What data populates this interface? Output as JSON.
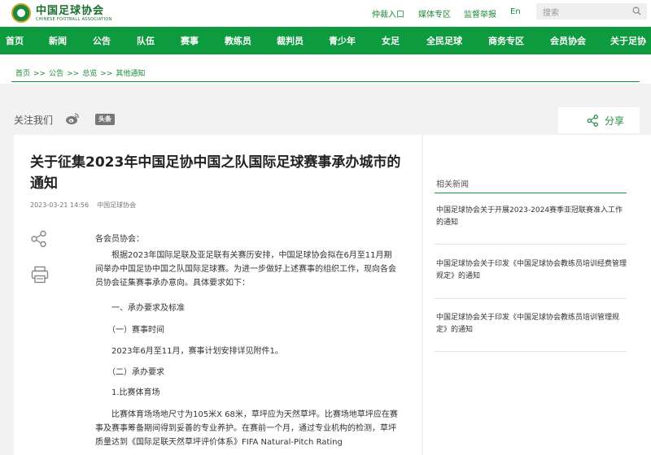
{
  "header": {
    "logo_cn": "中国足球协会",
    "logo_en": "CHINESE FOOTBALL ASSOCIATION",
    "links": [
      "仲裁入口",
      "媒体专区",
      "监督举报",
      "En"
    ],
    "search_placeholder": "搜索"
  },
  "nav": [
    "首页",
    "新闻",
    "公告",
    "队伍",
    "赛事",
    "教练员",
    "裁判员",
    "青少年",
    "女足",
    "全民足球",
    "商务专区",
    "会员协会",
    "关于足协"
  ],
  "breadcrumb": [
    "首页",
    "公告",
    "总览",
    "其他通知"
  ],
  "breadcrumb_sep": ">>",
  "share": {
    "follow_label": "关注我们",
    "toutiao_label": "头条",
    "share_label": "分享"
  },
  "article": {
    "title": "关于征集2023年中国足协中国之队国际足球赛事承办城市的通知",
    "date": "2023-03-21 14:56",
    "source": "中国足球协会",
    "lines": [
      "各会员协会：",
      "　　根据2023年国际足联及亚足联有关赛历安排，中国足球协会拟在6月至11月期",
      "间举办中国足协中国之队国际足球赛。为进一步做好上述赛事的组织工作，现向各会",
      "员协会征集赛事承办意向。具体要求如下：",
      "　　一、承办要求及标准",
      "　　（一）赛事时间",
      "　　2023年6月至11月，赛事计划安排详见附件1。",
      "　　（二）承办要求",
      "　　1.比赛体育场",
      "　　比赛体育场场地尺寸为105米X 68米，草坪应为天然草坪。比赛场地草坪应在赛",
      "事及赛事筹备期间得到妥善的专业养护。在赛前一个月，通过专业机构的检测，草坪",
      "质量达到《国际足联天然草坪评价体系》FIFA Natural-Pitch Rating"
    ]
  },
  "related": {
    "title": "相关新闻",
    "items": [
      "中国足球协会关于开展2023-2024赛季亚冠联赛准入工作的通知",
      "中国足球协会关于印发《中国足球协会教练员培训经费管理规定》的通知",
      "中国足球协会关于印发《中国足球协会教练员培训管理规定》的通知"
    ]
  },
  "colors": {
    "brand_green": "#0e9a3e",
    "link_green": "#1f8a3b"
  }
}
